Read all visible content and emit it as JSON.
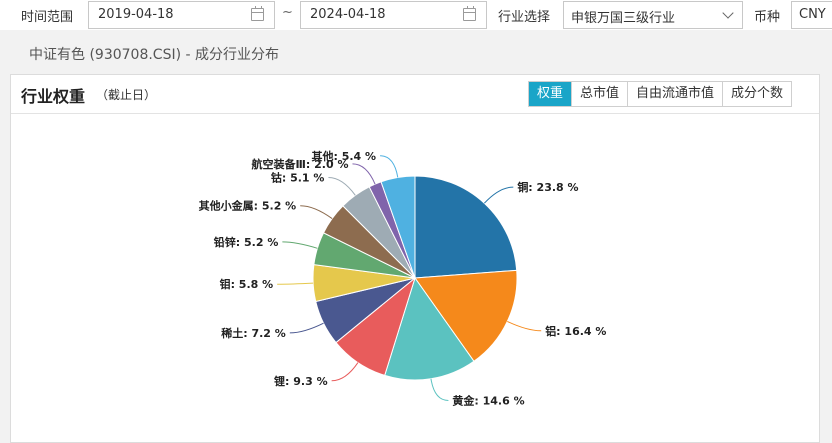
{
  "filters": {
    "time_range_label": "时间范围",
    "start_date": "2019-04-18",
    "separator": "~",
    "end_date": "2024-04-18",
    "industry_label": "行业选择",
    "industry_value": "申银万国三级行业",
    "currency_label": "币种",
    "currency_value": "CNY"
  },
  "subtitle": "中证有色 (930708.CSI) - 成分行业分布",
  "card": {
    "title": "行业权重",
    "title_note": "（截止日）",
    "tabs": [
      {
        "label": "权重",
        "active": true
      },
      {
        "label": "总市值",
        "active": false
      },
      {
        "label": "自由流通市值",
        "active": false
      },
      {
        "label": "成分个数",
        "active": false
      }
    ]
  },
  "chart_data": {
    "type": "pie",
    "unit": "%",
    "slices": [
      {
        "name": "铜",
        "value": 23.8,
        "label": "铜: 23.8 %",
        "color": "#2374a8"
      },
      {
        "name": "铝",
        "value": 16.4,
        "label": "铝: 16.4 %",
        "color": "#f5891b"
      },
      {
        "name": "黄金",
        "value": 14.6,
        "label": "黄金: 14.6 %",
        "color": "#5bc2c0"
      },
      {
        "name": "锂",
        "value": 9.3,
        "label": "锂: 9.3 %",
        "color": "#e85c5c"
      },
      {
        "name": "稀土",
        "value": 7.2,
        "label": "稀土: 7.2 %",
        "color": "#4a5890"
      },
      {
        "name": "钼",
        "value": 5.8,
        "label": "钼: 5.8 %",
        "color": "#e5c84c"
      },
      {
        "name": "铅锌",
        "value": 5.2,
        "label": "铅锌: 5.2 %",
        "color": "#62a870"
      },
      {
        "name": "其他小金属",
        "value": 5.2,
        "label": "其他小金属: 5.2 %",
        "color": "#8d6c4f"
      },
      {
        "name": "钴",
        "value": 5.1,
        "label": "钴: 5.1 %",
        "color": "#9eabb4"
      },
      {
        "name": "航空装备Ⅲ",
        "value": 2.0,
        "label": "航空装备Ⅲ: 2.0 %",
        "color": "#8064ab"
      },
      {
        "name": "其他",
        "value": 5.4,
        "label": "其他: 5.4 %",
        "color": "#4fb1e1"
      }
    ]
  }
}
